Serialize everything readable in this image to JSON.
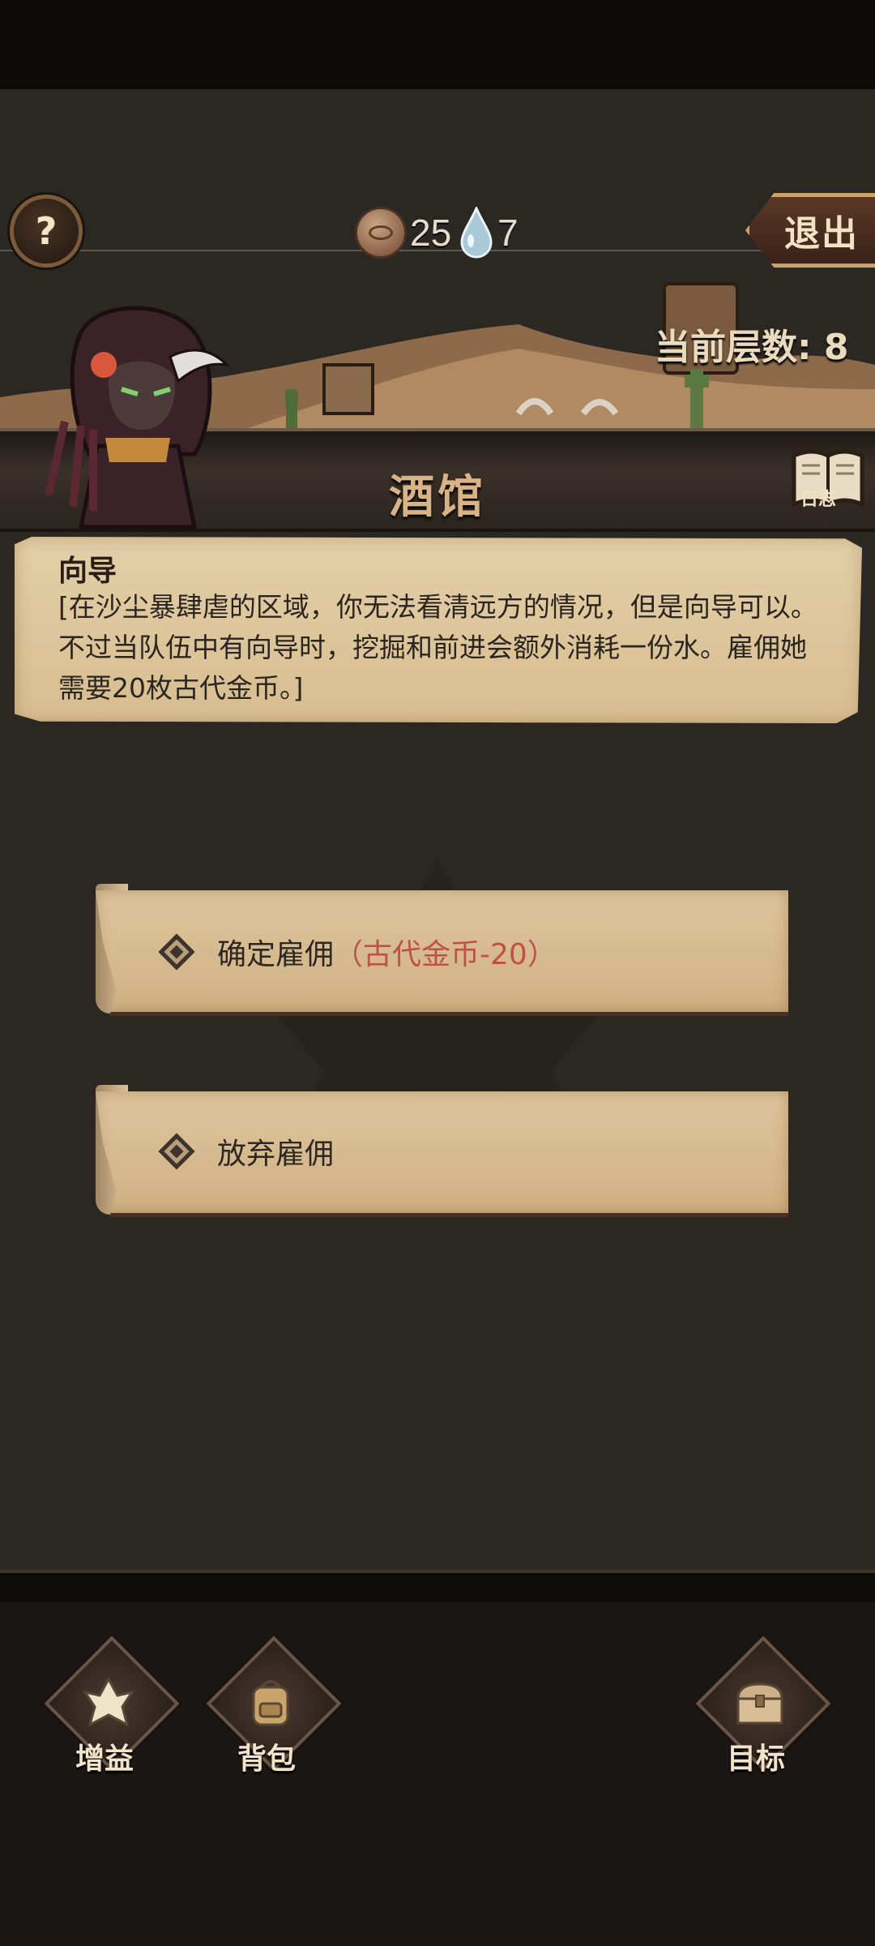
{
  "hud": {
    "help_label": "?",
    "coins": "25",
    "water": "7",
    "exit_label": "退出",
    "floor_text": "当前层数: 8"
  },
  "header": {
    "title": "酒馆",
    "log_label": "日志"
  },
  "event": {
    "title": "向导",
    "description": "[在沙尘暴肆虐的区域，你无法看清远方的情况，但是向导可以。不过当队伍中有向导时，挖掘和前进会额外消耗一份水。雇佣她需要20枚古代金币。]"
  },
  "options": [
    {
      "label": "确定雇佣",
      "cost": "（古代金币-20）"
    },
    {
      "label": "放弃雇佣",
      "cost": ""
    }
  ],
  "bottom_nav": [
    {
      "label": "增益",
      "icon": "buff-icon"
    },
    {
      "label": "背包",
      "icon": "backpack-icon"
    },
    {
      "label": "目标",
      "icon": "chest-icon"
    }
  ],
  "colors": {
    "cost_red": "#c0504a",
    "parchment": "#dcc49a",
    "background": "#2b2722"
  }
}
